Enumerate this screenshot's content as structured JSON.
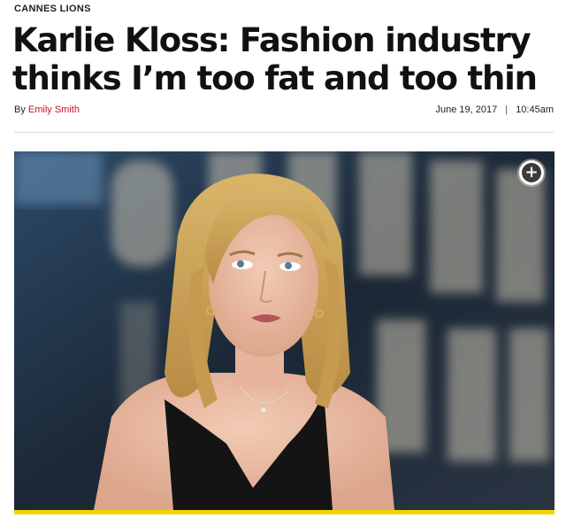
{
  "article": {
    "kicker": "CANNES LIONS",
    "headline": "Karlie Kloss: Fashion industry thinks I’m too fat and too thin",
    "byline_prefix": "By",
    "author": "Emily Smith",
    "date": "June 19, 2017",
    "separator": "|",
    "time": "10:45am"
  },
  "media": {
    "photo_subject": "woman-with-blonde-hair-portrait",
    "expand_icon": "plus-circle-icon",
    "expand_symbol": "+"
  },
  "colors": {
    "author_link": "#c8102e",
    "accent_bar": "#f2d600"
  }
}
